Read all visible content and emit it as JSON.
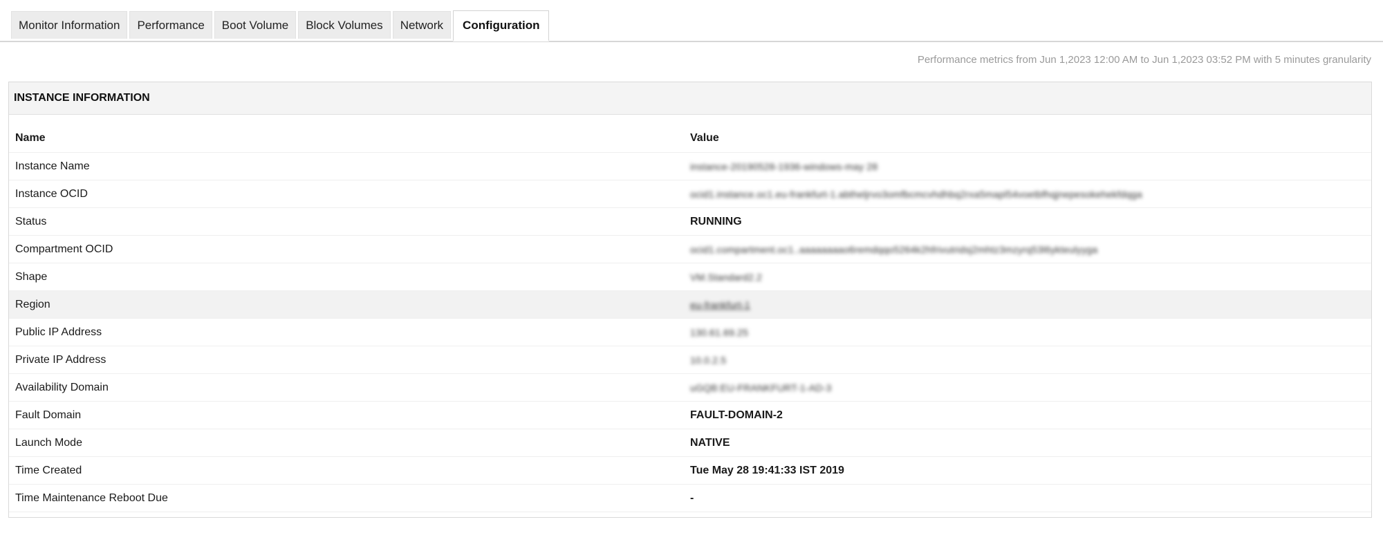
{
  "tabs": [
    {
      "label": "Monitor Information",
      "active": false
    },
    {
      "label": "Performance",
      "active": false
    },
    {
      "label": "Boot Volume",
      "active": false
    },
    {
      "label": "Block Volumes",
      "active": false
    },
    {
      "label": "Network",
      "active": false
    },
    {
      "label": "Configuration",
      "active": true
    }
  ],
  "metrics_note": "Performance metrics from Jun 1,2023 12:00 AM to Jun 1,2023 03:52 PM with 5 minutes granularity",
  "instance_info": {
    "title": "INSTANCE INFORMATION",
    "columns": {
      "name": "Name",
      "value": "Value"
    },
    "rows": [
      {
        "name": "Instance Name",
        "value": "instance-20190528-1936-windows-may 28"
      },
      {
        "name": "Instance OCID",
        "value": "ocid1.instance.oc1.eu-frankfurt-1.abtheljrvo3omfbcmcvhdhbq2rxa5mapl54voetbfhqjnepesokehekfdqga"
      },
      {
        "name": "Status",
        "value": "RUNNING"
      },
      {
        "name": "Compartment OCID",
        "value": "ocid1.compartment.oc1..aaaaaaaao6remdqqo5264k2hfrivutridsj2mhtz3mzyrq53l6ykteulyyga"
      },
      {
        "name": "Shape",
        "value": "VM.Standard2.2"
      },
      {
        "name": "Region",
        "value": "eu-frankfurt-1"
      },
      {
        "name": "Public IP Address",
        "value": "130.61.69.25"
      },
      {
        "name": "Private IP Address",
        "value": "10.0.2.5"
      },
      {
        "name": "Availability Domain",
        "value": "uGQB:EU-FRANKFURT-1-AD-3"
      },
      {
        "name": "Fault Domain",
        "value": "FAULT-DOMAIN-2"
      },
      {
        "name": "Launch Mode",
        "value": "NATIVE"
      },
      {
        "name": "Time Created",
        "value": "Tue May 28 19:41:33 IST 2019"
      },
      {
        "name": "Time Maintenance Reboot Due",
        "value": "-"
      }
    ]
  }
}
